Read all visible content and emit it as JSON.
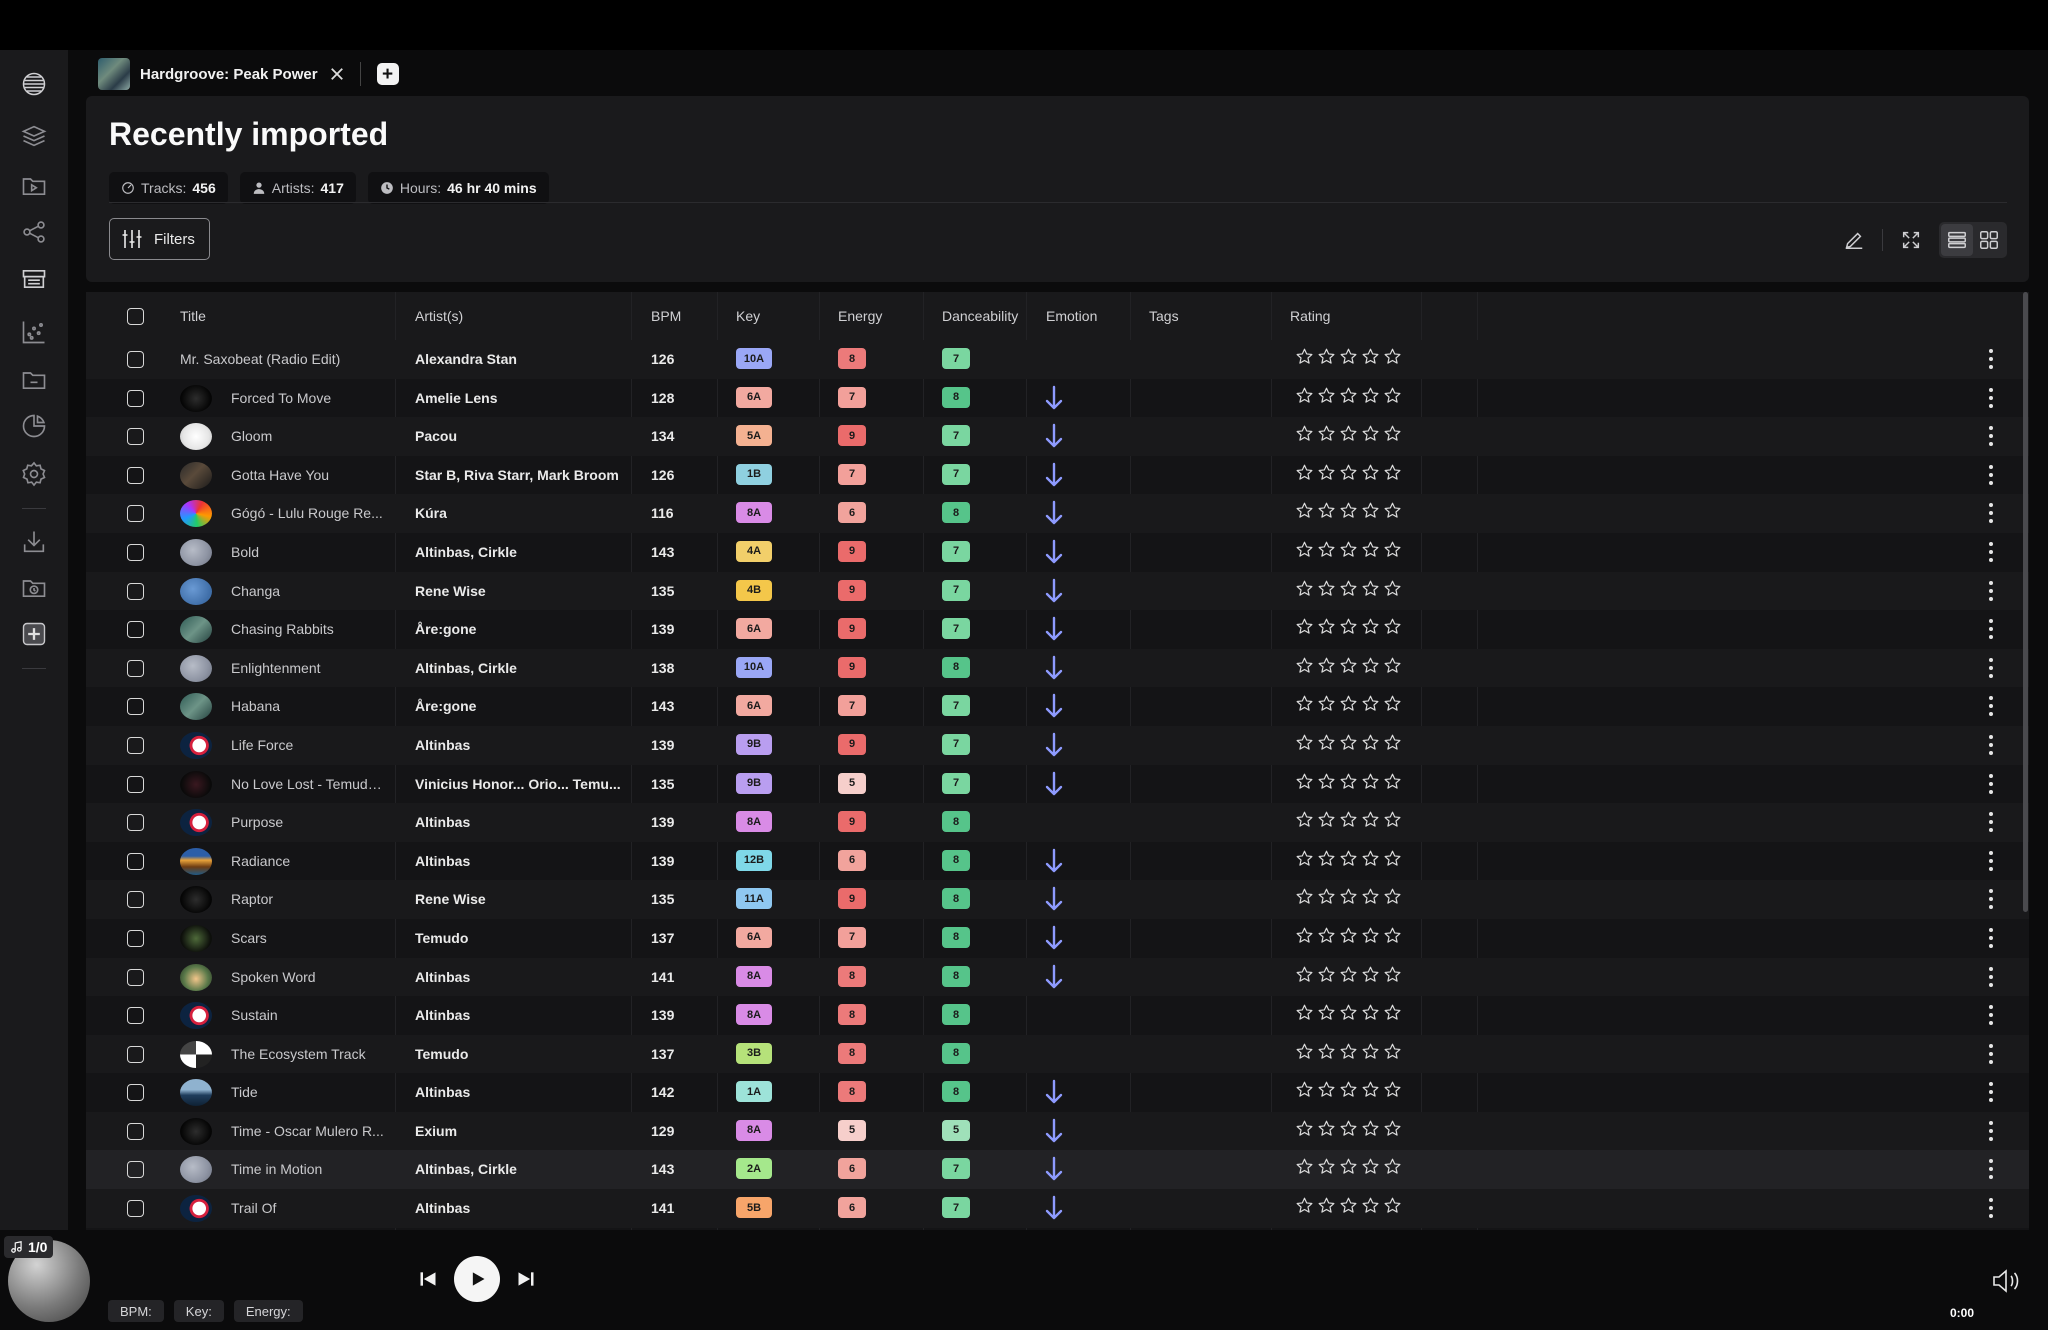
{
  "tab": {
    "title": "Hardgroove: Peak Power"
  },
  "page": {
    "title": "Recently imported",
    "stats": [
      {
        "label": "Tracks:",
        "value": "456",
        "icon": "disc-icon"
      },
      {
        "label": "Artists:",
        "value": "417",
        "icon": "person-icon"
      },
      {
        "label": "Hours:",
        "value": "46 hr 40 mins",
        "icon": "clock-icon"
      }
    ],
    "filters_label": "Filters"
  },
  "columns": {
    "title": "Title",
    "artists": "Artist(s)",
    "bpm": "BPM",
    "key": "Key",
    "energy": "Energy",
    "danceability": "Danceability",
    "emotion": "Emotion",
    "tags": "Tags",
    "rating": "Rating"
  },
  "colors": {
    "energy": {
      "8": "#ec7a7a",
      "7": "#f2a09a",
      "9": "#ea6b6b",
      "6": "#f1a39c",
      "5": "#f6cfcb"
    },
    "dance": {
      "7": "#7ad6a0",
      "8": "#56c48a",
      "5": "#9fe0b9"
    },
    "keys": {
      "10A": "#9aa7f6",
      "6A": "#f2a9a0",
      "5A": "#f4b191",
      "1B": "#8fd0e0",
      "8A": "#d98be6",
      "4A": "#f2cf6a",
      "4B": "#f4c74a",
      "9B": "#b99ef0",
      "12B": "#7fd8e8",
      "11A": "#8fc8f1",
      "3B": "#b6e27a",
      "1A": "#9de3d9",
      "2A": "#a5e88c",
      "5B": "#f7a56a"
    },
    "emotion_arrow": "#8e9bff"
  },
  "tracks": [
    {
      "title": "Mr. Saxobeat (Radio Edit)",
      "artist": "Alexandra Stan",
      "bpm": "126",
      "key": "10A",
      "energy": "8",
      "dance": "7",
      "emotion": false,
      "thumb": "none"
    },
    {
      "title": "Forced To Move",
      "artist": "Amelie Lens",
      "bpm": "128",
      "key": "6A",
      "energy": "7",
      "dance": "8",
      "emotion": true,
      "thumb": "dark"
    },
    {
      "title": "Gloom",
      "artist": "Pacou",
      "bpm": "134",
      "key": "5A",
      "energy": "9",
      "dance": "7",
      "emotion": true,
      "thumb": "white"
    },
    {
      "title": "Gotta Have You",
      "artist": "Star B,  Riva Starr,  Mark Broom",
      "bpm": "126",
      "key": "1B",
      "energy": "7",
      "dance": "7",
      "emotion": true,
      "thumb": "photo"
    },
    {
      "title": "Gógó - Lulu Rouge Re...",
      "artist": "Kúra",
      "bpm": "116",
      "key": "8A",
      "energy": "6",
      "dance": "8",
      "emotion": true,
      "thumb": "rainbow"
    },
    {
      "title": "Bold",
      "artist": "Altinbas,  Cirkle",
      "bpm": "143",
      "key": "4A",
      "energy": "9",
      "dance": "7",
      "emotion": true,
      "thumb": "grey"
    },
    {
      "title": "Changa",
      "artist": "Rene Wise",
      "bpm": "135",
      "key": "4B",
      "energy": "9",
      "dance": "7",
      "emotion": true,
      "thumb": "blue"
    },
    {
      "title": "Chasing Rabbits",
      "artist": "Åre:gone",
      "bpm": "139",
      "key": "6A",
      "energy": "9",
      "dance": "7",
      "emotion": true,
      "thumb": "teal"
    },
    {
      "title": "Enlightenment",
      "artist": "Altinbas,  Cirkle",
      "bpm": "138",
      "key": "10A",
      "energy": "9",
      "dance": "8",
      "emotion": true,
      "thumb": "grey"
    },
    {
      "title": "Habana",
      "artist": "Åre:gone",
      "bpm": "143",
      "key": "6A",
      "energy": "7",
      "dance": "7",
      "emotion": true,
      "thumb": "teal"
    },
    {
      "title": "Life Force",
      "artist": "Altinbas",
      "bpm": "139",
      "key": "9B",
      "energy": "9",
      "dance": "7",
      "emotion": true,
      "thumb": "moon"
    },
    {
      "title": "No Love Lost - Temudo...",
      "artist": "Vinicius Honor...  Orio...  Temu...",
      "bpm": "135",
      "key": "9B",
      "energy": "5",
      "dance": "7",
      "emotion": true,
      "thumb": "darkred"
    },
    {
      "title": "Purpose",
      "artist": "Altinbas",
      "bpm": "139",
      "key": "8A",
      "energy": "9",
      "dance": "8",
      "emotion": false,
      "thumb": "moon"
    },
    {
      "title": "Radiance",
      "artist": "Altinbas",
      "bpm": "139",
      "key": "12B",
      "energy": "6",
      "dance": "8",
      "emotion": true,
      "thumb": "sunset"
    },
    {
      "title": "Raptor",
      "artist": "Rene Wise",
      "bpm": "135",
      "key": "11A",
      "energy": "9",
      "dance": "8",
      "emotion": true,
      "thumb": "dark"
    },
    {
      "title": "Scars",
      "artist": "Temudo",
      "bpm": "137",
      "key": "6A",
      "energy": "7",
      "dance": "8",
      "emotion": true,
      "thumb": "green"
    },
    {
      "title": "Spoken Word",
      "artist": "Altinbas",
      "bpm": "141",
      "key": "8A",
      "energy": "8",
      "dance": "8",
      "emotion": true,
      "thumb": "sunset2"
    },
    {
      "title": "Sustain",
      "artist": "Altinbas",
      "bpm": "139",
      "key": "8A",
      "energy": "8",
      "dance": "8",
      "emotion": false,
      "thumb": "moon"
    },
    {
      "title": "The Ecosystem Track",
      "artist": "Temudo",
      "bpm": "137",
      "key": "3B",
      "energy": "8",
      "dance": "8",
      "emotion": false,
      "thumb": "checker"
    },
    {
      "title": "Tide",
      "artist": "Altinbas",
      "bpm": "142",
      "key": "1A",
      "energy": "8",
      "dance": "8",
      "emotion": true,
      "thumb": "sea"
    },
    {
      "title": "Time - Oscar Mulero R...",
      "artist": "Exium",
      "bpm": "129",
      "key": "8A",
      "energy": "5",
      "dance": "5",
      "emotion": true,
      "thumb": "dark"
    },
    {
      "title": "Time in Motion",
      "artist": "Altinbas,  Cirkle",
      "bpm": "143",
      "key": "2A",
      "energy": "6",
      "dance": "7",
      "emotion": true,
      "thumb": "grey",
      "highlight": true
    },
    {
      "title": "Trail Of",
      "artist": "Altinbas",
      "bpm": "141",
      "key": "5B",
      "energy": "6",
      "dance": "7",
      "emotion": true,
      "thumb": "moon"
    }
  ],
  "player": {
    "deck_count": "1/0",
    "bpm_label": "BPM:",
    "key_label": "Key:",
    "energy_label": "Energy:",
    "time": "0:00"
  }
}
